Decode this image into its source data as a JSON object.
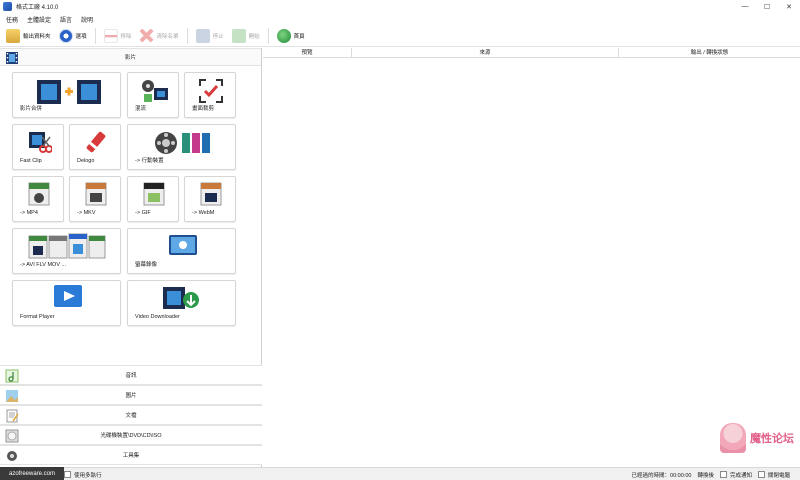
{
  "window": {
    "title": "格式工廠 4.10.0",
    "controls": [
      "—",
      "☐",
      "✕"
    ]
  },
  "menu": [
    "任務",
    "主體設定",
    "語言",
    "說明"
  ],
  "toolbar": {
    "items": [
      {
        "label": "輸出資料夾",
        "icon": "folder-icon",
        "enabled": true
      },
      {
        "label": "選項",
        "icon": "options-icon",
        "enabled": true
      },
      {
        "label": "移除",
        "icon": "remove-icon",
        "enabled": false
      },
      {
        "label": "清除名單",
        "icon": "clear-list-icon",
        "enabled": false
      },
      {
        "label": "停止",
        "icon": "stop-icon",
        "enabled": false
      },
      {
        "label": "開始",
        "icon": "start-icon",
        "enabled": false
      },
      {
        "label": "首頁",
        "icon": "home-globe-icon",
        "enabled": true
      }
    ]
  },
  "left": {
    "video_section": "影片",
    "tiles": [
      {
        "label": "影片合併",
        "icon": "video-merge-icon"
      },
      {
        "label": "混流",
        "icon": "mux-icon"
      },
      {
        "label": "畫面裁剪",
        "icon": "crop-check-icon"
      },
      {
        "label": "Fast Clip",
        "icon": "fast-clip-icon"
      },
      {
        "label": "Delogo",
        "icon": "delogo-icon"
      },
      {
        "label": "-> 行動裝置",
        "icon": "mobile-device-icon"
      },
      {
        "label": "-> MP4",
        "icon": "mp4-icon"
      },
      {
        "label": "-> MKV",
        "icon": "mkv-icon"
      },
      {
        "label": "-> GIF",
        "icon": "gif-icon"
      },
      {
        "label": "-> WebM",
        "icon": "webm-icon"
      },
      {
        "label": "-> AVI FLV MOV ...",
        "icon": "avi-flv-mov-icon"
      },
      {
        "label": "螢幕錄像",
        "icon": "screen-record-icon"
      },
      {
        "label": "Format Player",
        "icon": "format-player-icon"
      },
      {
        "label": "Video Downloader",
        "icon": "video-downloader-icon"
      }
    ],
    "sections": [
      {
        "label": "音訊",
        "icon": "audio-icon"
      },
      {
        "label": "圖片",
        "icon": "picture-icon"
      },
      {
        "label": "文檔",
        "icon": "document-icon"
      },
      {
        "label": "光碟機裝置\\DVD\\CD\\ISO",
        "icon": "disc-icon"
      },
      {
        "label": "工具集",
        "icon": "tools-icon"
      }
    ]
  },
  "right": {
    "columns": [
      "預覽",
      "來源",
      "輸出 / 轉換狀態"
    ]
  },
  "status": {
    "left_label": "使用多執行",
    "elapsed_label": "已經過的時間：00:00:00",
    "after_label": "轉換後",
    "notify_label": "完成通知",
    "shutdown_label": "關閉電腦"
  },
  "watermarks": {
    "left": "azofreeware.com",
    "right": "魔性论坛"
  },
  "colors": {
    "accent_blue": "#2a62c9",
    "tile_border": "#d6d6d6",
    "watermark_pink": "#e2628a"
  }
}
